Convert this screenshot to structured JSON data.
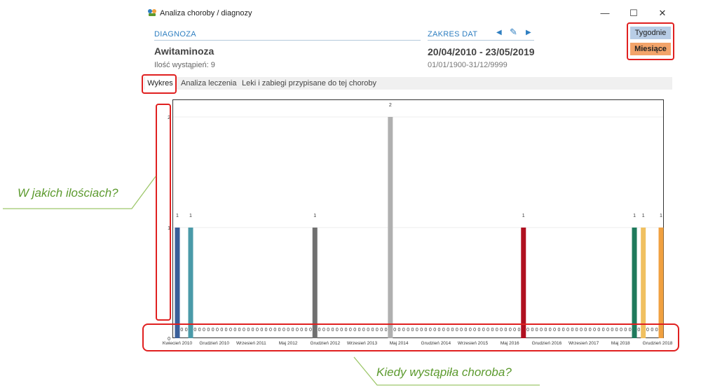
{
  "window": {
    "title": "Analiza choroby / diagnozy",
    "controls": {
      "minimize": "—",
      "maximize": "☐",
      "close": "✕"
    }
  },
  "diagnosis": {
    "label": "DIAGNOZA",
    "name": "Awitaminoza",
    "count_text": "Ilość wystąpień: 9"
  },
  "date_range": {
    "label": "ZAKRES DAT",
    "main": "20/04/2010 - 23/05/2019",
    "sub": "01/01/1900-31/12/9999",
    "prev": "◀",
    "edit": "✎",
    "next": "▶"
  },
  "period_buttons": {
    "weekly": "Tygodnie",
    "monthly": "Miesiące"
  },
  "tabs": [
    {
      "label": "Wykres",
      "active": true
    },
    {
      "label": "Analiza leczenia",
      "active": false
    },
    {
      "label": "Leki i zabiegi przypisane do tej choroby",
      "active": false
    }
  ],
  "annotations": {
    "left": "W jakich ilościach?",
    "bottom": "Kiedy wystąpiła choroba?"
  },
  "colors": {
    "accent": "#2f7fc1",
    "weekly_btn": "#b8cde6",
    "monthly_btn": "#f3a46a",
    "highlight": "#e02020",
    "annotation": "#5c9a2e"
  },
  "chart_data": {
    "type": "bar",
    "ylim": [
      0,
      2
    ],
    "yticks": [
      "0",
      "1",
      "2"
    ],
    "xtick_labels": [
      "Kwiecień 2010",
      "Grudzień 2010",
      "Wrzesień 2011",
      "Maj 2012",
      "Grudzień 2012",
      "Wrzesień 2013",
      "Maj 2014",
      "Grudzień 2014",
      "Wrzesień 2015",
      "Maj 2016",
      "Grudzień 2016",
      "Wrzesień 2017",
      "Maj 2018",
      "Grudzień 2018"
    ],
    "month_count": 110,
    "bars": [
      {
        "month": "Kwiecień 2010",
        "index": 0,
        "value": 1,
        "color": "#3a5f9a"
      },
      {
        "month": "Czerwiec 2010",
        "index": 3,
        "value": 1,
        "color": "#4a9aa8"
      },
      {
        "month": "Listopad 2012",
        "index": 31,
        "value": 1,
        "color": "#707070"
      },
      {
        "month": "Kwiecień 2014",
        "index": 48,
        "value": 2,
        "color": "#b0b0b0"
      },
      {
        "month": "Wrzesień 2016",
        "index": 78,
        "value": 1,
        "color": "#b01020"
      },
      {
        "month": "Grudzień 2018",
        "index": 103,
        "value": 1,
        "color": "#1f7a5c"
      },
      {
        "month": "Styczeń 2019",
        "index": 105,
        "value": 1,
        "color": "#f0c060"
      },
      {
        "month": "Maj 2019",
        "index": 109,
        "value": 1,
        "color": "#f0a040"
      }
    ]
  }
}
